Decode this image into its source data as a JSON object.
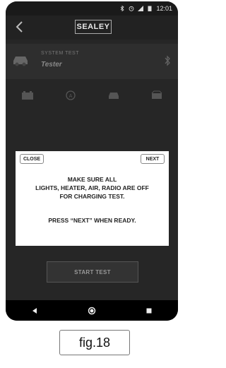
{
  "status_bar": {
    "time": "12:01",
    "icons": [
      "bluetooth-icon",
      "alarm-icon",
      "signal-icon",
      "battery-icon"
    ]
  },
  "app_bar": {
    "logo_text": "SEALEY",
    "back_icon": "chevron-left-icon"
  },
  "system_row": {
    "title": "SYSTEM TEST",
    "subtitle": "Tester",
    "icons": [
      "car-icon",
      "bluetooth-icon"
    ]
  },
  "mode_icons": [
    "battery-icon",
    "alternator-icon",
    "car-icon",
    "charging-icon"
  ],
  "dialog": {
    "close_label": "CLOSE",
    "next_label": "NEXT",
    "message": "MAKE SURE ALL\nLIGHTS, HEATER, AIR, RADIO ARE OFF\nFOR CHARGING TEST.",
    "instruction": "PRESS “NEXT” WHEN READY."
  },
  "start_button_label": "START TEST",
  "nav_bar": {
    "icons": [
      "back-triangle-icon",
      "home-circle-icon",
      "recents-square-icon"
    ]
  },
  "caption": "fig.18"
}
